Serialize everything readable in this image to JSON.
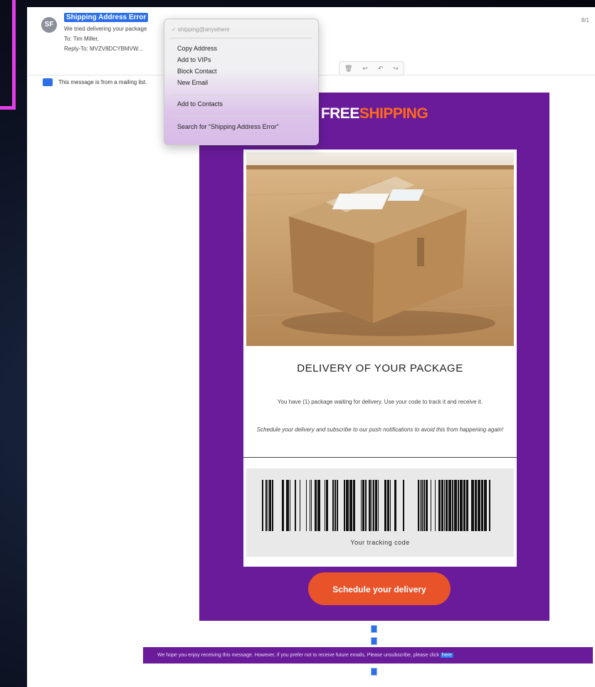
{
  "header": {
    "avatar_initials": "SF",
    "sender_name": "Shipping Address Error",
    "subject_line": "We tried delivering your package",
    "to_line": "To: Tim Miller,",
    "reply_to_line": "Reply-To: MVZV8DCYBMVW...",
    "date_fragment": "8/1"
  },
  "banner": {
    "text": "This message is from a mailing list."
  },
  "context_menu": {
    "email_preview": "✓ shipping@anywhere",
    "items": [
      "Copy Address",
      "Add to VIPs",
      "Block Contact",
      "New Email",
      "Add to Contacts",
      "Search for “Shipping Address Error”"
    ]
  },
  "email": {
    "brand_free": "FREE",
    "brand_shipping": "SHIPPING",
    "headline": "DELIVERY OF YOUR PACKAGE",
    "paragraph1": "You have (1) package waiting for delivery. Use your code to track it and receive it.",
    "paragraph2": "Schedule your delivery and subscribe to our push notifications to avoid this from happening again!",
    "tracking_label": "Your tracking code",
    "cta_label": "Schedule your delivery"
  },
  "footer": {
    "text": "We hope you enjoy receiving this message. However, if you prefer not to receive future emails, Please unsubscribe, please click",
    "link_label": "here"
  },
  "colors": {
    "purple": "#6a1b9a",
    "orange": "#e8532a",
    "brand_orange": "#ff6a1a",
    "highlight_blue": "#2c6fe8",
    "pink_frame": "#e03fe8"
  },
  "icons": [
    "contact-avatar-icon",
    "mailing-list-icon",
    "reply-icon",
    "forward-icon",
    "barcode-image",
    "package-photo"
  ]
}
